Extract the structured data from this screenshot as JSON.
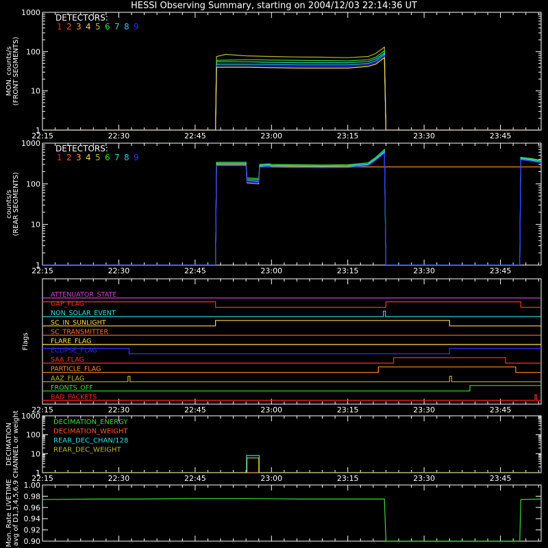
{
  "title": "HESSI Observing Summary, starting on 2004/12/03 22:14:36 UT",
  "colors": {
    "background": "#000000",
    "axes": "#ffffff",
    "detector_colors": [
      "#ff2020",
      "#ff5a2a",
      "#ff9d2a",
      "#ffd83a",
      "#b8b82a",
      "#34e034",
      "#2ee0c8",
      "#30c0ff",
      "#3030ff"
    ]
  },
  "chart_data": [
    {
      "type": "line",
      "panel": "front",
      "ylabel": [
        "MON. counts/s",
        "(FRONT SEGMENTS)"
      ],
      "ylog": true,
      "ylim": [
        1,
        1000
      ],
      "yticks": [
        "1",
        "10",
        "100",
        "1000"
      ],
      "xlim": [
        0,
        98
      ],
      "xticks": [
        {
          "t": 0,
          "label": "22:15"
        },
        {
          "t": 15,
          "label": "22:30"
        },
        {
          "t": 30,
          "label": "22:45"
        },
        {
          "t": 45,
          "label": "23:00"
        },
        {
          "t": 60,
          "label": "23:15"
        },
        {
          "t": 75,
          "label": "23:30"
        },
        {
          "t": 90,
          "label": "23:45"
        }
      ],
      "legend": {
        "title": "DETECTORS:",
        "labels": [
          "1",
          "2",
          "3",
          "4",
          "5",
          "6",
          "7",
          "8",
          "9"
        ]
      },
      "series": [
        {
          "color": "#b8b82a",
          "x": [
            0,
            34,
            34.2,
            36,
            40,
            45,
            50,
            55,
            60,
            64,
            65.5,
            67.2,
            67.5,
            98
          ],
          "y": [
            1,
            1,
            75,
            85,
            78,
            75,
            73,
            72,
            70,
            75,
            90,
            130,
            1,
            1
          ]
        },
        {
          "color": "#34e034",
          "x": [
            0,
            34,
            34.2,
            40,
            50,
            60,
            64,
            65.5,
            67.2,
            67.5,
            98
          ],
          "y": [
            1,
            1,
            60,
            62,
            60,
            58,
            62,
            72,
            105,
            1,
            1
          ]
        },
        {
          "color": "#2ee0c8",
          "x": [
            0,
            34,
            34.2,
            40,
            50,
            60,
            64,
            65.5,
            67.2,
            67.5,
            98
          ],
          "y": [
            1,
            1,
            55,
            55,
            52,
            52,
            56,
            65,
            92,
            1,
            1
          ]
        },
        {
          "color": "#30c0ff",
          "x": [
            0,
            34,
            34.2,
            40,
            50,
            60,
            64,
            65.5,
            67.2,
            67.5,
            98
          ],
          "y": [
            1,
            1,
            48,
            48,
            46,
            46,
            50,
            58,
            85,
            1,
            1
          ]
        },
        {
          "color": "#3030ff",
          "x": [
            0,
            34,
            34.2,
            40,
            50,
            60,
            64,
            65.5,
            67.2,
            67.5,
            98
          ],
          "y": [
            1,
            1,
            44,
            44,
            42,
            42,
            46,
            52,
            78,
            1,
            1
          ]
        },
        {
          "color": "#ffd83a",
          "x": [
            0,
            34,
            34.2,
            40,
            50,
            60,
            64,
            65.5,
            67.2,
            67.5,
            98
          ],
          "y": [
            1,
            1,
            40,
            40,
            38,
            38,
            42,
            48,
            70,
            1,
            1
          ]
        }
      ]
    },
    {
      "type": "line",
      "panel": "rear",
      "ylabel": [
        "counts/s",
        "(REAR SEGMENTS)"
      ],
      "ylog": true,
      "ylim": [
        1,
        1000
      ],
      "yticks": [
        "1",
        "10",
        "100",
        "1000"
      ],
      "xlim": [
        0,
        98
      ],
      "xticks": [
        {
          "t": 0,
          "label": "22:15"
        },
        {
          "t": 15,
          "label": "22:30"
        },
        {
          "t": 30,
          "label": "22:45"
        },
        {
          "t": 45,
          "label": "23:00"
        },
        {
          "t": 60,
          "label": "23:15"
        },
        {
          "t": 75,
          "label": "23:30"
        },
        {
          "t": 90,
          "label": "23:45"
        }
      ],
      "legend": {
        "title": "DETECTORS:",
        "labels": [
          "1",
          "2",
          "3",
          "4",
          "5",
          "6",
          "7",
          "8",
          "9"
        ]
      },
      "series": [
        {
          "color": "#34e034",
          "x": [
            0,
            34,
            34.2,
            40,
            40.2,
            42.5,
            42.7,
            44.5,
            45,
            50,
            55,
            60,
            64,
            65.5,
            67.2,
            67.5,
            93.8,
            94,
            96,
            98
          ],
          "y": [
            1,
            1,
            340,
            340,
            140,
            135,
            300,
            310,
            300,
            295,
            290,
            295,
            330,
            450,
            700,
            1,
            1,
            450,
            420,
            380
          ]
        },
        {
          "color": "#2ee0c8",
          "x": [
            0,
            34,
            34.2,
            40,
            40.2,
            42.5,
            42.7,
            44.5,
            45,
            50,
            55,
            60,
            64,
            65.5,
            67.2,
            67.5,
            93.8,
            94,
            96,
            98
          ],
          "y": [
            1,
            1,
            320,
            320,
            130,
            125,
            285,
            295,
            285,
            280,
            275,
            280,
            310,
            420,
            640,
            1,
            1,
            430,
            400,
            360
          ]
        },
        {
          "color": "#30c0ff",
          "x": [
            0,
            34,
            34.2,
            40,
            40.2,
            42.5,
            42.7,
            44.5,
            45,
            50,
            55,
            60,
            64,
            65.5,
            67.2,
            67.5,
            93.8,
            94,
            96,
            98
          ],
          "y": [
            1,
            1,
            300,
            300,
            120,
            115,
            270,
            280,
            270,
            265,
            262,
            265,
            295,
            400,
            600,
            1,
            1,
            410,
            380,
            340
          ]
        },
        {
          "color": "#ff9d2a",
          "x": [
            0,
            34,
            34.2,
            40,
            40.2,
            42.5,
            42.7,
            98
          ],
          "y": [
            1,
            1,
            290,
            290,
            105,
            100,
            260,
            260
          ]
        },
        {
          "color": "#3030ff",
          "x": [
            0,
            34,
            34.2,
            40,
            40.2,
            42.5,
            42.7,
            44.5,
            45,
            50,
            55,
            60,
            64,
            65.5,
            67.2,
            67.5,
            93.8,
            94,
            96,
            98
          ],
          "y": [
            1,
            1,
            280,
            280,
            110,
            108,
            255,
            265,
            255,
            250,
            248,
            250,
            280,
            380,
            560,
            1,
            1,
            390,
            360,
            330
          ]
        }
      ]
    },
    {
      "type": "line",
      "panel": "flags",
      "ylabel": [
        "Flags"
      ],
      "xlim": [
        0,
        98
      ],
      "xticks": [
        {
          "t": 0,
          "label": "22:15"
        },
        {
          "t": 15,
          "label": "22:30"
        },
        {
          "t": 30,
          "label": "22:45"
        },
        {
          "t": 45,
          "label": "23:00"
        },
        {
          "t": 60,
          "label": "23:15"
        },
        {
          "t": 75,
          "label": "23:30"
        },
        {
          "t": 90,
          "label": "23:45"
        }
      ],
      "flags": [
        {
          "name": "ATTENUATOR_STATE",
          "color": "#d040d0",
          "x": [
            0,
            98
          ],
          "on": [
            0,
            0
          ]
        },
        {
          "name": "GAP_FLAG",
          "color": "#ff3020",
          "x": [
            0,
            34,
            34,
            67.5,
            67.5,
            94,
            94,
            98
          ],
          "on": [
            1,
            1,
            0,
            0,
            1,
            1,
            0,
            0
          ]
        },
        {
          "name": "NON_SOLAR_EVENT",
          "color": "#2ee0e0",
          "x": [
            0,
            67,
            67,
            67.4,
            67.4,
            98
          ],
          "on": [
            0,
            0,
            1,
            1,
            0,
            0
          ]
        },
        {
          "name": "SC_IN_SUNLIGHT",
          "color": "#ffd83a",
          "x": [
            0,
            34,
            34,
            80,
            80,
            98
          ],
          "on": [
            0,
            0,
            1,
            1,
            0,
            0
          ]
        },
        {
          "name": "SC_TRANSMITTER",
          "color": "#ff6a2a",
          "x": [
            0,
            98
          ],
          "on": [
            0,
            0
          ]
        },
        {
          "name": "FLARE_FLAG",
          "color": "#ffe040",
          "x": [
            0,
            98
          ],
          "on": [
            0,
            0
          ]
        },
        {
          "name": "ECLIPSE_FLAG",
          "color": "#3030ff",
          "x": [
            0,
            17,
            17,
            80,
            80,
            98
          ],
          "on": [
            1,
            1,
            0,
            0,
            1,
            1
          ]
        },
        {
          "name": "SAA_FLAG",
          "color": "#ff3020",
          "x": [
            0,
            69,
            69,
            91,
            91,
            98
          ],
          "on": [
            0,
            0,
            1,
            1,
            0,
            0
          ]
        },
        {
          "name": "PARTICLE_FLAG",
          "color": "#ff8a20",
          "x": [
            0,
            66,
            66,
            93,
            93,
            98
          ],
          "on": [
            0,
            0,
            1,
            1,
            0,
            0
          ]
        },
        {
          "name": "AAZ_FLAG",
          "color": "#b8b82a",
          "x": [
            0,
            16.8,
            16.8,
            17.2,
            17.2,
            80,
            80,
            80.4,
            80.4,
            98
          ],
          "on": [
            0,
            0,
            1,
            1,
            0,
            0,
            1,
            1,
            0,
            0
          ]
        },
        {
          "name": "FRONTS_OFF",
          "color": "#34e034",
          "x": [
            0,
            84,
            84,
            98
          ],
          "on": [
            0,
            0,
            1,
            1
          ]
        },
        {
          "name": "BAD_PACKETS",
          "color": "#ff2020",
          "x": [
            0,
            96.8,
            96.8,
            97.1,
            97.1,
            98
          ],
          "on": [
            0,
            0,
            1,
            1,
            0,
            0
          ]
        }
      ]
    },
    {
      "type": "line",
      "panel": "decimation",
      "ylabel": [
        "DECIMATION",
        "CHANNEL or weight"
      ],
      "ylog": true,
      "ylim": [
        1,
        1000
      ],
      "yticks": [
        "1",
        "10",
        "100",
        "1000"
      ],
      "xlim": [
        0,
        98
      ],
      "xticks": [
        {
          "t": 0,
          "label": "22:15"
        },
        {
          "t": 15,
          "label": "22:30"
        },
        {
          "t": 30,
          "label": "22:45"
        },
        {
          "t": 45,
          "label": "23:00"
        },
        {
          "t": 60,
          "label": "23:15"
        },
        {
          "t": 75,
          "label": "23:30"
        },
        {
          "t": 90,
          "label": "23:45"
        }
      ],
      "legend": {
        "labels": [
          "DECIMATION_ENERGY",
          "DECIMATION_WEIGHT",
          "REAR_DEC_CHAN/128",
          "REAR_DEC_WEIGHT"
        ]
      },
      "series": [
        {
          "name": "DECIMATION_ENERGY",
          "color": "#34e034",
          "x": [
            0,
            98
          ],
          "y": [
            1,
            1
          ]
        },
        {
          "name": "DECIMATION_WEIGHT",
          "color": "#ff5a2a",
          "x": [
            0,
            98
          ],
          "y": [
            1,
            1
          ]
        },
        {
          "name": "REAR_DEC_CHAN/128",
          "color": "#2ee0e0",
          "x": [
            0,
            40.1,
            40.1,
            42.6,
            42.6,
            98
          ],
          "y": [
            1,
            1,
            8,
            8,
            1,
            1
          ]
        },
        {
          "name": "REAR_DEC_WEIGHT",
          "color": "#b8b82a",
          "x": [
            0,
            40.2,
            40.2,
            42.5,
            42.5,
            98
          ],
          "y": [
            1,
            1,
            6,
            6,
            1,
            1
          ]
        }
      ]
    },
    {
      "type": "line",
      "panel": "livetime",
      "ylabel": [
        "Mon. Rate LIVETIME",
        "avg of D1,3,4,5,6,9"
      ],
      "ylog": false,
      "ylim": [
        0.9,
        1.0
      ],
      "yticks": [
        "0.90",
        "0.92",
        "0.94",
        "0.96",
        "0.98",
        "1.00"
      ],
      "xlim": [
        0,
        98
      ],
      "series": [
        {
          "color": "#34e034",
          "x": [
            0,
            10,
            20,
            30,
            40,
            50,
            60,
            67.2,
            67.5,
            93.8,
            94,
            98
          ],
          "y": [
            0.974,
            0.975,
            0.975,
            0.976,
            0.976,
            0.975,
            0.975,
            0.975,
            0.9,
            0.9,
            0.974,
            0.975
          ]
        }
      ]
    }
  ]
}
